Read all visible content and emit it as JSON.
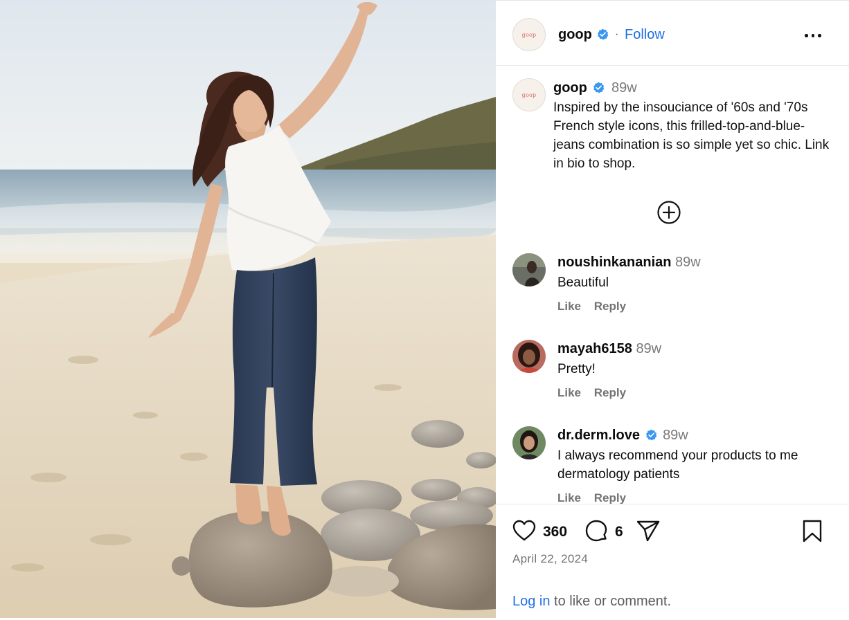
{
  "post": {
    "author": "goop",
    "avatar_text": "goop",
    "verified": true,
    "separator": "·",
    "follow_label": "Follow",
    "more_icon": "more-horizontal-icon"
  },
  "caption": {
    "author": "goop",
    "time": "89w",
    "text": "Inspired by the insouciance of '60s and '70s French style icons, this frilled-top-and-blue-jeans combination is so simple yet so chic. Link in bio to shop."
  },
  "load_more_icon": "plus-circle-icon",
  "comments": [
    {
      "user": "noushinkananian",
      "verified": false,
      "time": "89w",
      "text": "Beautiful",
      "like_label": "Like",
      "reply_label": "Reply"
    },
    {
      "user": "mayah6158",
      "verified": false,
      "time": "89w",
      "text": "Pretty!",
      "like_label": "Like",
      "reply_label": "Reply"
    },
    {
      "user": "dr.derm.love",
      "verified": true,
      "time": "89w",
      "text": "I always recommend your products to me dermatology patients",
      "like_label": "Like",
      "reply_label": "Reply"
    }
  ],
  "actions": {
    "likes": "360",
    "comments": "6",
    "like_icon": "heart-icon",
    "comment_icon": "comment-bubble-icon",
    "share_icon": "paper-plane-icon",
    "save_icon": "bookmark-icon"
  },
  "date": "April 22, 2024",
  "login": {
    "link_label": "Log in",
    "rest_text": " to like or comment."
  },
  "colors": {
    "link_blue": "#1f6fe5",
    "verified_blue": "#3897f0",
    "muted_gray": "#737373"
  }
}
